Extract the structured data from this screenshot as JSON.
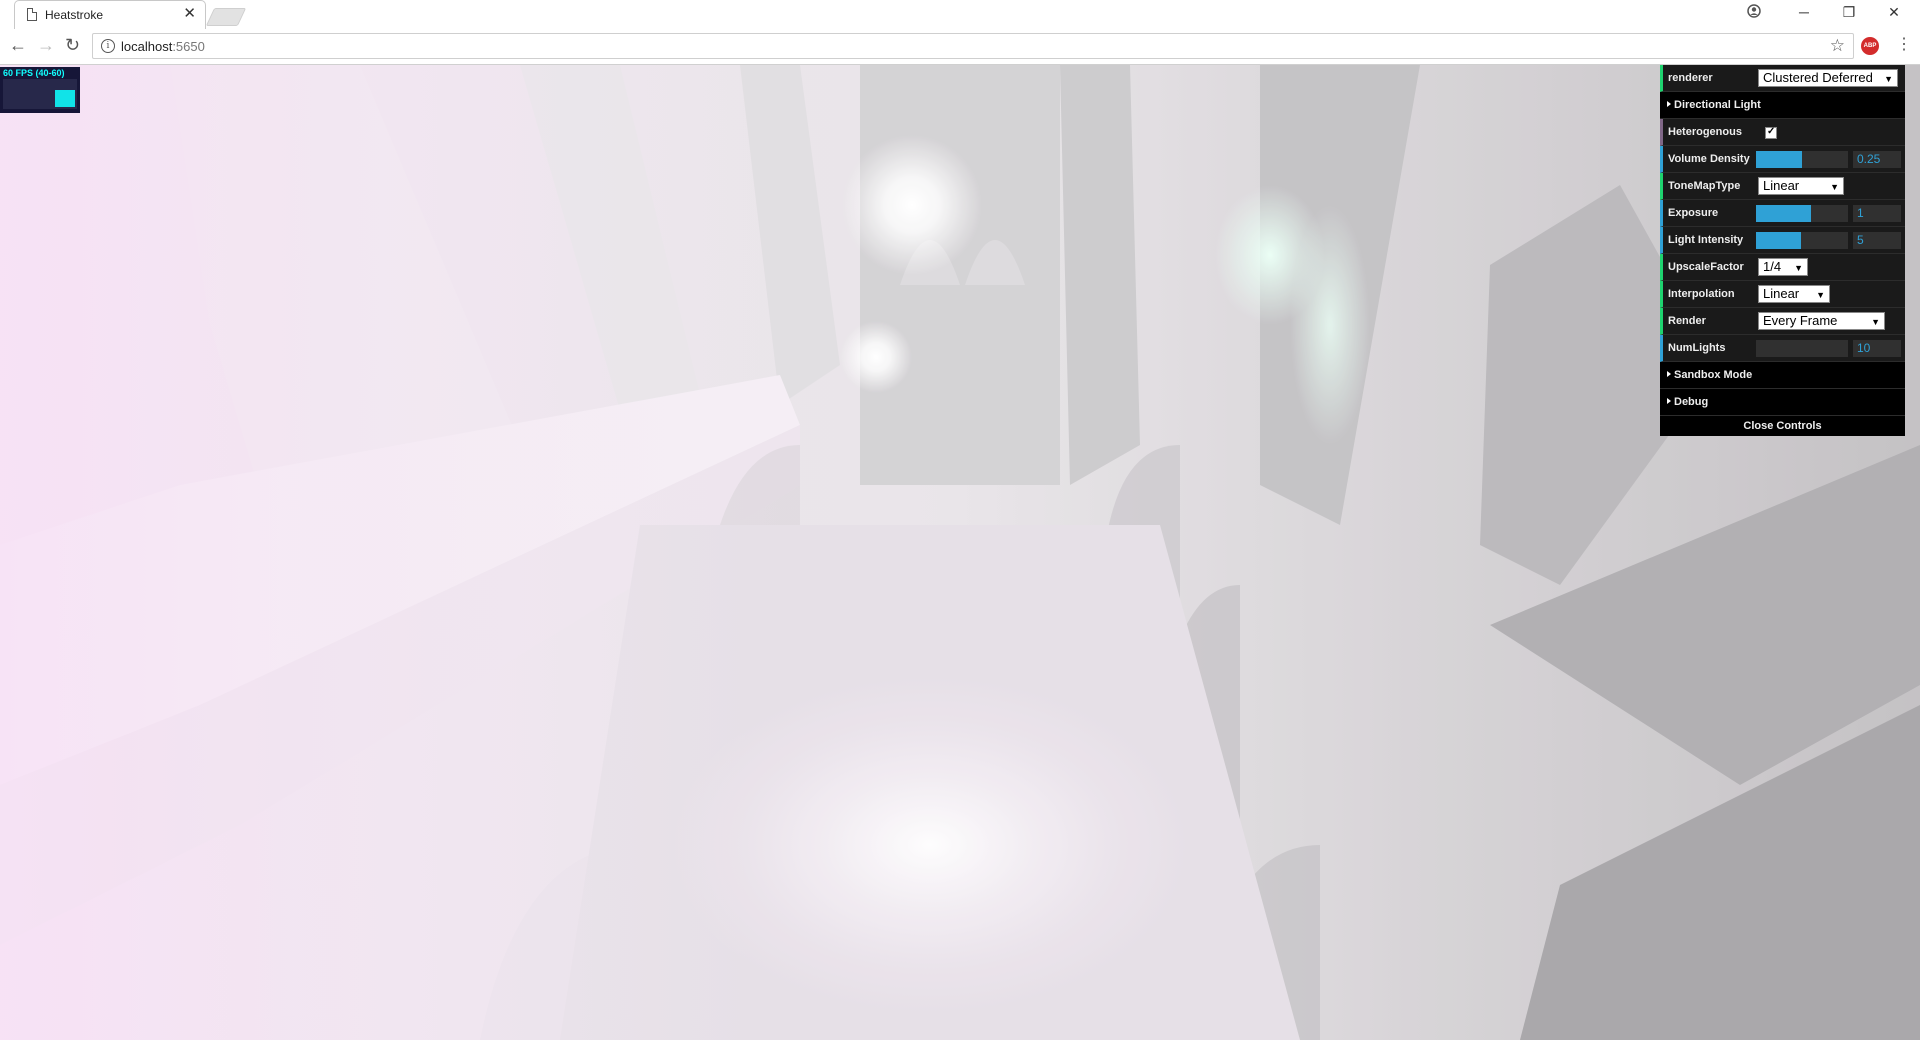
{
  "browser": {
    "tab_title": "Heatstroke",
    "tab_close": "✕",
    "url_host": "localhost",
    "url_port": ":5650",
    "window_minimize": "─",
    "window_restore": "❐",
    "window_close": "✕",
    "abp_label": "ABP"
  },
  "fps_meter": {
    "label": "60 FPS (40-60)"
  },
  "gui": {
    "renderer": {
      "label": "renderer",
      "value": "Clustered Deferred"
    },
    "folder_directional": "Directional Light",
    "heterogenous": {
      "label": "Heterogenous",
      "checked": true
    },
    "volume_density": {
      "label": "Volume Density",
      "value": "0.25",
      "fill": 0.5
    },
    "tonemap": {
      "label": "ToneMapType",
      "value": "Linear"
    },
    "exposure": {
      "label": "Exposure",
      "value": "1",
      "fill": 0.6
    },
    "light_intensity": {
      "label": "Light Intensity",
      "value": "5",
      "fill": 0.5
    },
    "upscale": {
      "label": "UpscaleFactor",
      "value": "1/4"
    },
    "interpolation": {
      "label": "Interpolation",
      "value": "Linear"
    },
    "render": {
      "label": "Render",
      "value": "Every Frame"
    },
    "num_lights": {
      "label": "NumLights",
      "value": "10",
      "fill": 0.0
    },
    "folder_sandbox": "Sandbox Mode",
    "folder_debug": "Debug",
    "close_controls": "Close Controls"
  },
  "colors": {
    "accent_green": "#1ed36f",
    "accent_blue": "#2fa1d6",
    "accent_purple": "#806787"
  }
}
